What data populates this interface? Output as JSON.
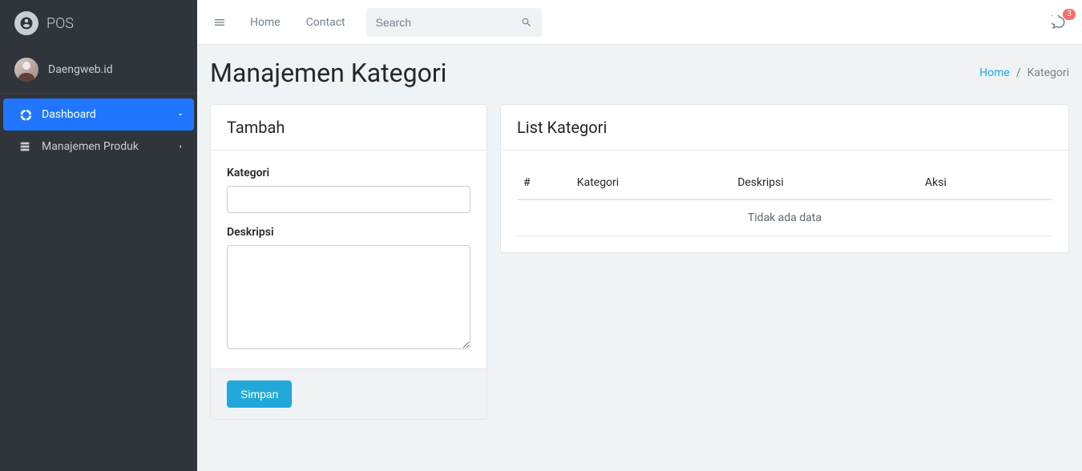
{
  "brand": {
    "name": "POS"
  },
  "user": {
    "name": "Daengweb.id"
  },
  "sidebar": {
    "items": [
      {
        "label": "Dashboard",
        "active": true,
        "expandable": true
      },
      {
        "label": "Manajemen Produk",
        "active": false,
        "expandable": true
      }
    ]
  },
  "topbar": {
    "links": [
      "Home",
      "Contact"
    ],
    "search_placeholder": "Search",
    "search_value": "",
    "notif_count": "3"
  },
  "page": {
    "title": "Manajemen Kategori",
    "breadcrumb_home": "Home",
    "breadcrumb_sep": "/",
    "breadcrumb_current": "Kategori"
  },
  "form_card": {
    "title": "Tambah",
    "fields": {
      "kategori_label": "Kategori",
      "kategori_value": "",
      "deskripsi_label": "Deskripsi",
      "deskripsi_value": ""
    },
    "submit_label": "Simpan"
  },
  "list_card": {
    "title": "List Kategori",
    "columns": [
      "#",
      "Kategori",
      "Deskripsi",
      "Aksi"
    ],
    "empty_text": "Tidak ada data"
  }
}
